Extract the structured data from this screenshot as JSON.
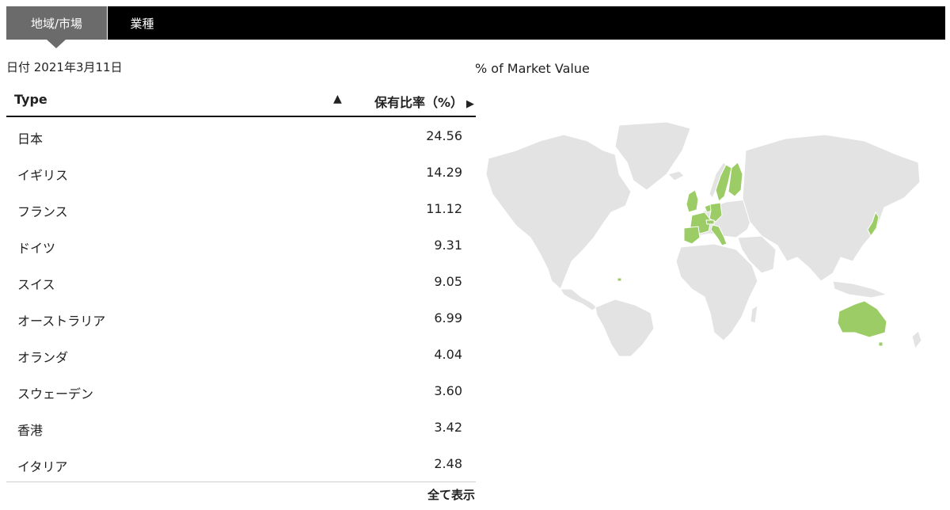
{
  "tabs": {
    "region": "地域/市場",
    "sector": "業種"
  },
  "date_label": "日付 2021年3月11日",
  "table": {
    "col_type": "Type",
    "sort_asc_icon": "▲",
    "col_pct": "保有比率（%）",
    "pct_arrow": "▶",
    "rows": [
      {
        "name": "日本",
        "value": "24.56"
      },
      {
        "name": "イギリス",
        "value": "14.29"
      },
      {
        "name": "フランス",
        "value": "11.12"
      },
      {
        "name": "ドイツ",
        "value": "9.31"
      },
      {
        "name": "スイス",
        "value": "9.05"
      },
      {
        "name": "オーストラリア",
        "value": "6.99"
      },
      {
        "name": "オランダ",
        "value": "4.04"
      },
      {
        "name": "スウェーデン",
        "value": "3.60"
      },
      {
        "name": "香港",
        "value": "3.42"
      },
      {
        "name": "イタリア",
        "value": "2.48"
      }
    ],
    "show_all": "全て表示"
  },
  "map": {
    "title": "% of Market Value",
    "land_color": "#e3e3e3",
    "highlight_color": "#9ccc65"
  }
}
